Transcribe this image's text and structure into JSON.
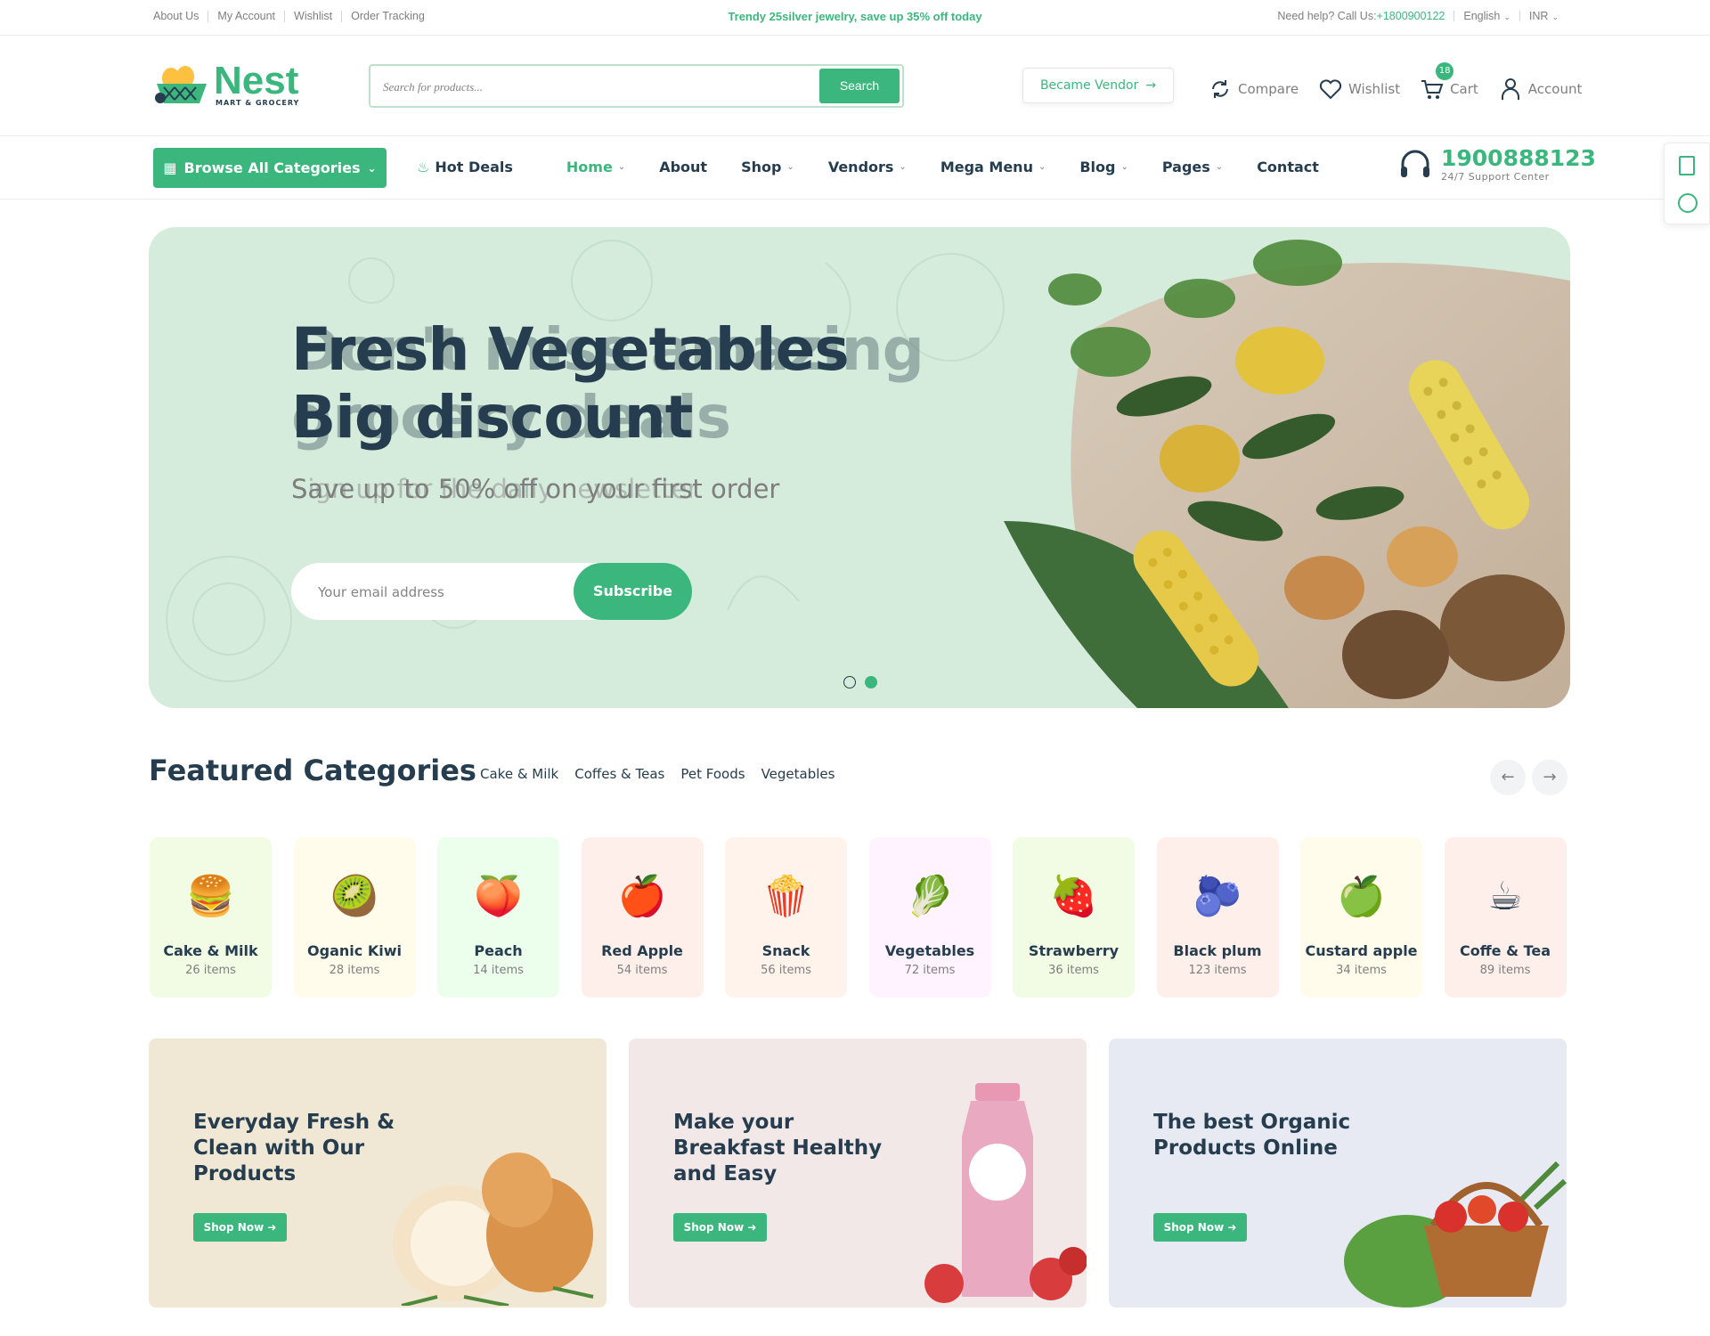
{
  "topbar": {
    "links": [
      "About Us",
      "My Account",
      "Wishlist",
      "Order Tracking"
    ],
    "promo": "Trendy 25silver jewelry, save up 35% off today",
    "help_prefix": "Need help? Call Us:",
    "help_phone": "+1800900122",
    "language": "English",
    "currency": "INR"
  },
  "header": {
    "logo_word": "Nest",
    "logo_sub": "MART & GROCERY",
    "search_placeholder": "Search for products...",
    "search_button": "Search",
    "vendor_button": "Became Vendor",
    "compare": "Compare",
    "wishlist": "Wishlist",
    "cart": "Cart",
    "cart_count": "18",
    "account": "Account"
  },
  "nav": {
    "browse": "Browse All Categories",
    "hot_deals": "Hot Deals",
    "items": [
      {
        "label": "Home",
        "dropdown": true,
        "active": true
      },
      {
        "label": "About",
        "dropdown": false
      },
      {
        "label": "Shop",
        "dropdown": true
      },
      {
        "label": "Vendors",
        "dropdown": true
      },
      {
        "label": "Mega Menu",
        "dropdown": true
      },
      {
        "label": "Blog",
        "dropdown": true
      },
      {
        "label": "Pages",
        "dropdown": true
      },
      {
        "label": "Contact",
        "dropdown": false
      }
    ],
    "support_number": "1900888123",
    "support_label": "24/7 Support Center"
  },
  "hero": {
    "title_line1": "Fresh Vegetables",
    "title_line2": "Big discount",
    "ghost_line1": "Don't miss amazing",
    "ghost_line2": "grocery deals",
    "subtitle": "Save up to 50% off on your first order",
    "ghost_subtitle": "Sign up for the daily newsletter",
    "email_placeholder": "Your email address",
    "subscribe": "Subscribe",
    "slides": 2,
    "active_slide": 2
  },
  "featured": {
    "title": "Featured Categories",
    "tabs": [
      "Cake & Milk",
      "Coffes & Teas",
      "Pet Foods",
      "Vegetables"
    ],
    "categories": [
      {
        "name": "Cake & Milk",
        "count": "26 items",
        "bg": "#F2FCE4",
        "icon": "burger-icon",
        "glyph": "🍔"
      },
      {
        "name": "Oganic Kiwi",
        "count": "28 items",
        "bg": "#FFFCEB",
        "icon": "kiwi-icon",
        "glyph": "🥝"
      },
      {
        "name": "Peach",
        "count": "14 items",
        "bg": "#ECFFEC",
        "icon": "peach-icon",
        "glyph": "🍑"
      },
      {
        "name": "Red Apple",
        "count": "54 items",
        "bg": "#FEEFEA",
        "icon": "apple-icon",
        "glyph": "🍎"
      },
      {
        "name": "Snack",
        "count": "56 items",
        "bg": "#FFF3EB",
        "icon": "snack-icon",
        "glyph": "🍿"
      },
      {
        "name": "Vegetables",
        "count": "72 items",
        "bg": "#FFF3FF",
        "icon": "cabbage-icon",
        "glyph": "🥬"
      },
      {
        "name": "Strawberry",
        "count": "36 items",
        "bg": "#F2FCE4",
        "icon": "strawberry-icon",
        "glyph": "🍓"
      },
      {
        "name": "Black plum",
        "count": "123 items",
        "bg": "#FEEFEA",
        "icon": "plum-icon",
        "glyph": "🫐"
      },
      {
        "name": "Custard apple",
        "count": "34 items",
        "bg": "#FFFCEB",
        "icon": "custard-apple-icon",
        "glyph": "🍏"
      },
      {
        "name": "Coffe & Tea",
        "count": "89 items",
        "bg": "#FEEFEA",
        "icon": "coffee-icon",
        "glyph": "☕"
      }
    ]
  },
  "banners": [
    {
      "title": "Everyday Fresh & Clean with Our Products",
      "button": "Shop Now",
      "bg": "#F0E8D5",
      "icon": "onion-icon",
      "glyph": "🧅"
    },
    {
      "title": "Make your Breakfast Healthy and Easy",
      "button": "Shop Now",
      "bg": "#F3E8E8",
      "icon": "juice-bottle-icon",
      "glyph": "🍼"
    },
    {
      "title": "The best Organic Products Online",
      "button": "Shop Now",
      "bg": "#E7EAF3",
      "icon": "vegetable-basket-icon",
      "glyph": "🧺"
    }
  ],
  "colors": {
    "brand": "#3BB77E",
    "heading": "#253D4E",
    "muted": "#7E7E7E",
    "hero_bg": "#D5EBDB"
  }
}
